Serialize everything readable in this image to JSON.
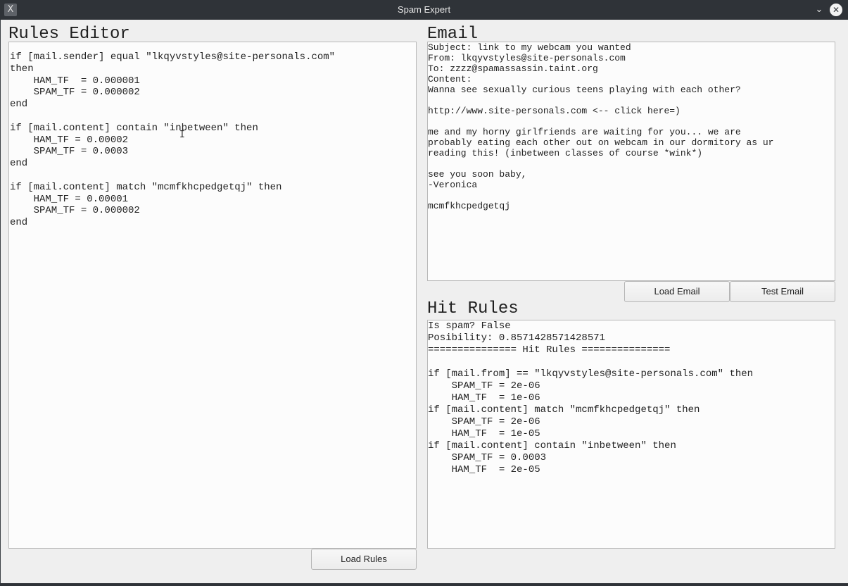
{
  "window": {
    "title": "Spam Expert",
    "app_icon": "x-app-icon",
    "menu_glyph": "⌄",
    "close_glyph": "✕"
  },
  "rules_editor": {
    "heading": "Rules Editor",
    "content": "if [mail.sender] equal \"lkqyvstyles@site-personals.com\"\nthen\n    HAM_TF  = 0.000001\n    SPAM_TF = 0.000002\nend\n\nif [mail.content] contain \"inbetween\" then\n    HAM_TF = 0.00002\n    SPAM_TF = 0.0003\nend\n\nif [mail.content] match \"mcmfkhcpedgetqj\" then\n    HAM_TF = 0.00001\n    SPAM_TF = 0.000002\nend",
    "load_button": "Load Rules"
  },
  "email": {
    "heading": "Email",
    "content": "Subject: link to my webcam you wanted\nFrom: lkqyvstyles@site-personals.com\nTo: zzzz@spamassassin.taint.org\nContent:\nWanna see sexually curious teens playing with each other?\n\nhttp://www.site-personals.com <-- click here=)\n\nme and my horny girlfriends are waiting for you... we are\nprobably eating each other out on webcam in our dormitory as ur\nreading this! (inbetween classes of course *wink*)\n\nsee you soon baby,\n-Veronica\n\nmcmfkhcpedgetqj",
    "load_button": "Load Email",
    "test_button": "Test Email"
  },
  "hit_rules": {
    "heading": "Hit Rules",
    "content": "Is spam? False\nPosibility: 0.8571428571428571\n=============== Hit Rules ===============\n\nif [mail.from] == \"lkqyvstyles@site-personals.com\" then\n    SPAM_TF = 2e-06\n    HAM_TF  = 1e-06\nif [mail.content] match \"mcmfkhcpedgetqj\" then\n    SPAM_TF = 2e-06\n    HAM_TF  = 1e-05\nif [mail.content] contain \"inbetween\" then\n    SPAM_TF = 0.0003\n    HAM_TF  = 2e-05"
  },
  "colors": {
    "titlebar": "#2f3338",
    "window_bg": "#efefef",
    "panel_bg": "#fcfcfc",
    "border": "#b9b9b9"
  }
}
